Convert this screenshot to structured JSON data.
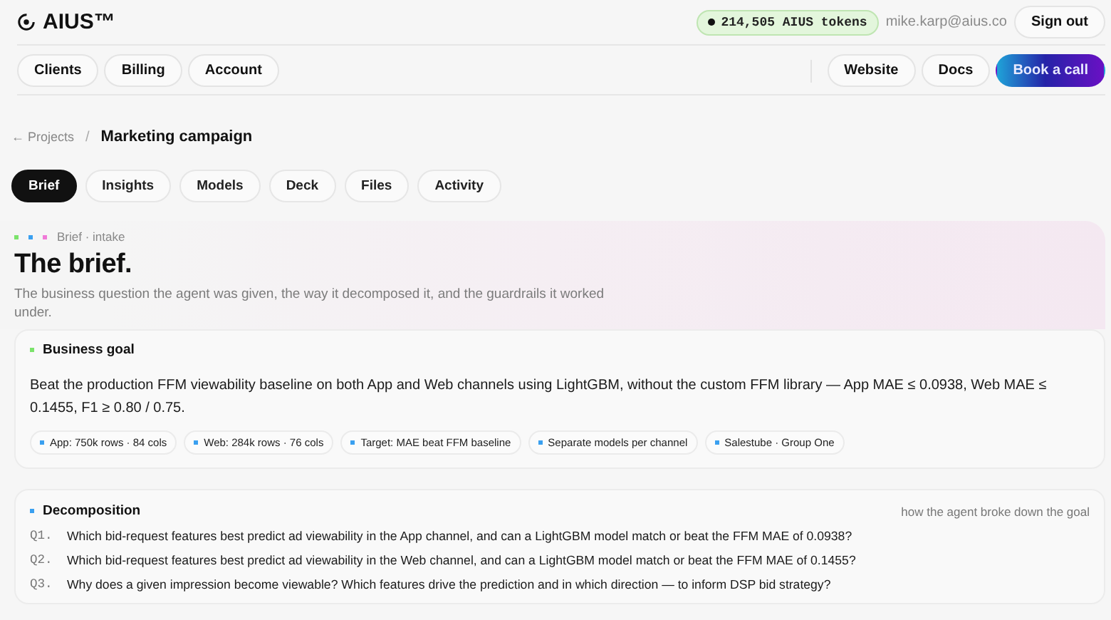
{
  "brand": {
    "name": "AIUS™"
  },
  "account": {
    "tokens": "214,505 AIUS tokens",
    "email": "mike.karp@aius.co",
    "sign_out": "Sign out"
  },
  "nav_left": [
    {
      "label": "Clients"
    },
    {
      "label": "Billing"
    },
    {
      "label": "Account"
    }
  ],
  "nav_right": [
    {
      "label": "Website",
      "kind": "plain"
    },
    {
      "label": "Docs",
      "kind": "plain"
    },
    {
      "label": "Book a call",
      "kind": "primary"
    }
  ],
  "breadcrumb": {
    "back": "← Projects",
    "separator": "/",
    "current": "Marketing campaign"
  },
  "tabs": [
    {
      "label": "Brief",
      "selected": true
    },
    {
      "label": "Insights",
      "selected": false
    },
    {
      "label": "Models",
      "selected": false
    },
    {
      "label": "Deck",
      "selected": false
    },
    {
      "label": "Files",
      "selected": false
    },
    {
      "label": "Activity",
      "selected": false
    }
  ],
  "hero": {
    "dots": [
      {
        "color": "#7be36b"
      },
      {
        "color": "#3aa0f0"
      },
      {
        "color": "#f07ad8"
      }
    ],
    "eyebrow": "Brief · intake",
    "title": "The brief.",
    "description": "The business question the agent was given, the way it decomposed it, and the guardrails it worked under."
  },
  "business_goal": {
    "heading": "Business goal",
    "color": "#7be36b",
    "text": "Beat the production FFM viewability baseline on both App and Web channels using LightGBM, without the custom FFM library — App MAE ≤ 0.0938, Web MAE ≤ 0.1455, F1 ≥ 0.80 / 0.75.",
    "chips": [
      "App: 750k rows · 84 cols",
      "Web: 284k rows · 76 cols",
      "Target: MAE beat FFM baseline",
      "Separate models per channel",
      "Salestube · Group One"
    ]
  },
  "decomposition": {
    "heading": "Decomposition",
    "color": "#3aa0f0",
    "note": "how the agent broke down the goal",
    "questions": [
      {
        "number": "Q1.",
        "text": "Which bid-request features best predict ad viewability in the App channel, and can a LightGBM model match or beat the FFM MAE of 0.0938?"
      },
      {
        "number": "Q2.",
        "text": "Which bid-request features best predict ad viewability in the Web channel, and can a LightGBM model match or beat the FFM MAE of 0.1455?"
      },
      {
        "number": "Q3.",
        "text": "Why does a given impression become viewable? Which features drive the prediction and in which direction — to inform DSP bid strategy?"
      }
    ]
  }
}
